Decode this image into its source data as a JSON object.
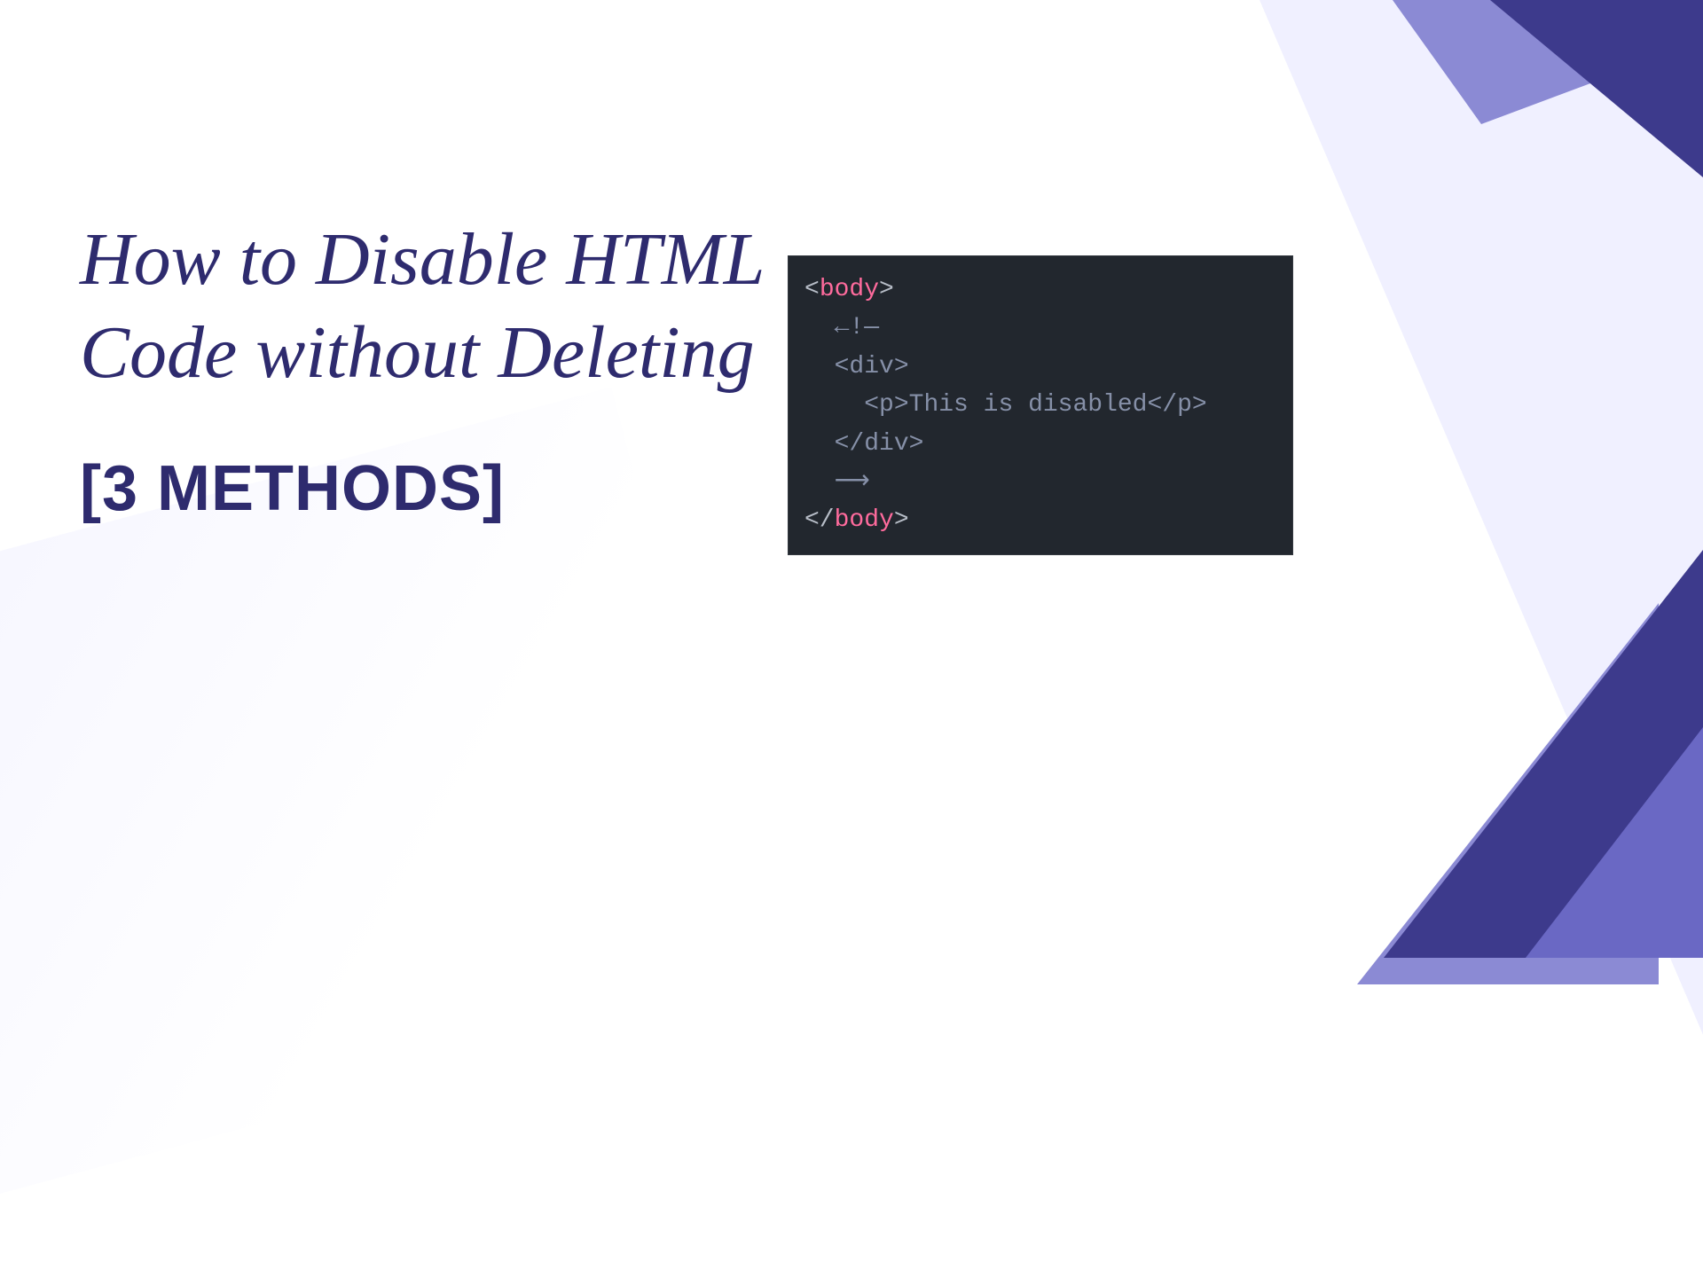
{
  "heading": {
    "title": "How to Disable HTML Code without Deleting",
    "subtitle": "[3 METHODS]"
  },
  "code": {
    "line1_open": "<",
    "line1_tag": "body",
    "line1_close": ">",
    "line2": "  ←!—",
    "line3_open": "  <",
    "line3_tag": "div",
    "line3_close": ">",
    "line4_open": "    <",
    "line4_tag_p": "p",
    "line4_mid": ">",
    "line4_text": "This is disabled",
    "line4_closeopen": "</",
    "line4_end": ">",
    "line5_open": "  </",
    "line5_tag": "div",
    "line5_close": ">",
    "line6": "  ⟶",
    "line7_open": "</",
    "line7_tag": "body",
    "line7_close": ">"
  },
  "colors": {
    "dark_navy": "#2e2b6e",
    "shape_dark": "#3d3a8c",
    "shape_light": "#8b8ad4",
    "code_bg": "#22272e",
    "code_tag": "#ff6b9d",
    "code_comment": "#8690a8",
    "code_text": "#b8bec8"
  }
}
